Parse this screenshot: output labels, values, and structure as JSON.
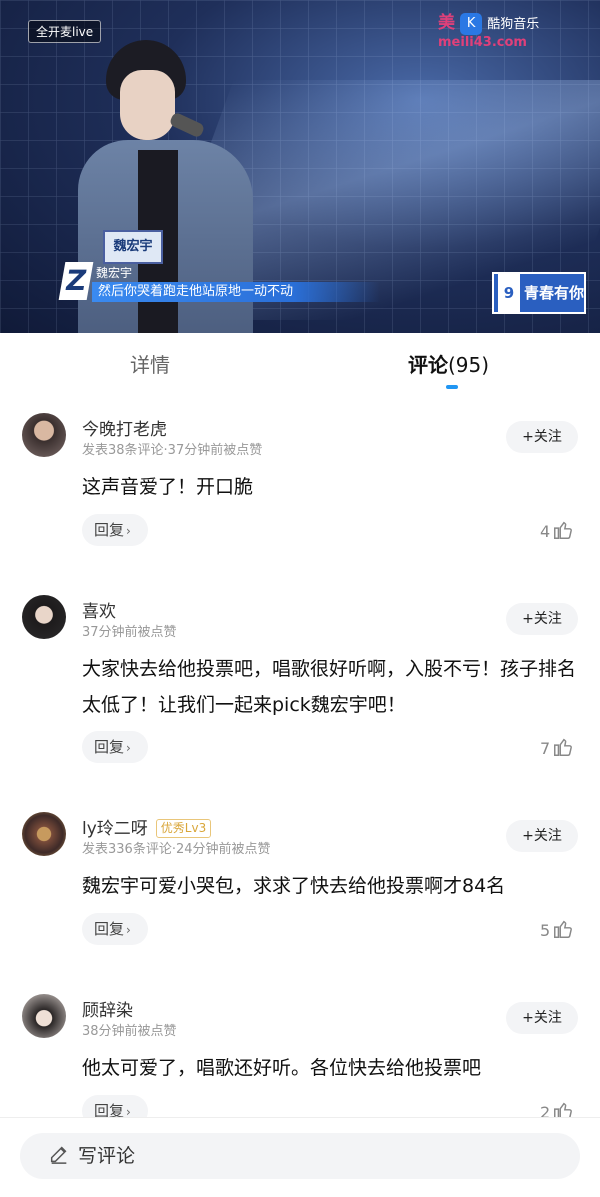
{
  "video": {
    "live_badge": "全开麦live",
    "watermark": {
      "brand": "美",
      "music_label": "酷狗音乐",
      "app_icon_letter": "K",
      "url": "meili43.com"
    },
    "subtitle_logo": "Z",
    "subtitle_name": "魏宏宇",
    "subtitle_text": "然后你哭着跑走他站原地一动不动",
    "nametag_text": "魏宏宇",
    "show_logo": {
      "num": "9",
      "title": "青春有你"
    }
  },
  "tabs": {
    "details_label": "详情",
    "comments_label": "评论",
    "comments_count": "(95)"
  },
  "colors": {
    "accent": "#2196f3",
    "level_badge": "#d9a63a",
    "watermark": "#e0407a"
  },
  "comments": [
    {
      "user": "今晚打老虎",
      "meta": "发表38条评论·37分钟前被点赞",
      "follow_label": "+关注",
      "text": "这声音爱了！开口脆",
      "reply_label": "回复",
      "likes": "4"
    },
    {
      "user": "喜欢",
      "meta": "37分钟前被点赞",
      "follow_label": "+关注",
      "text": "大家快去给他投票吧，唱歌很好听啊，入股不亏！孩子排名太低了！让我们一起来pick魏宏宇吧！",
      "reply_label": "回复",
      "likes": "7"
    },
    {
      "user": "ly玲二呀",
      "level": "优秀Lv3",
      "meta": "发表336条评论·24分钟前被点赞",
      "follow_label": "+关注",
      "text": "魏宏宇可爱小哭包，求求了快去给他投票啊才84名",
      "reply_label": "回复",
      "likes": "5"
    },
    {
      "user": "顾辞染",
      "meta": "38分钟前被点赞",
      "follow_label": "+关注",
      "text": "他太可爱了，唱歌还好听。各位快去给他投票吧",
      "reply_label": "回复",
      "likes": "2"
    }
  ],
  "bottom": {
    "write_comment_label": "写评论"
  },
  "icons": [
    "pencil-icon",
    "thumbs-up-icon",
    "chevron-right-icon"
  ]
}
